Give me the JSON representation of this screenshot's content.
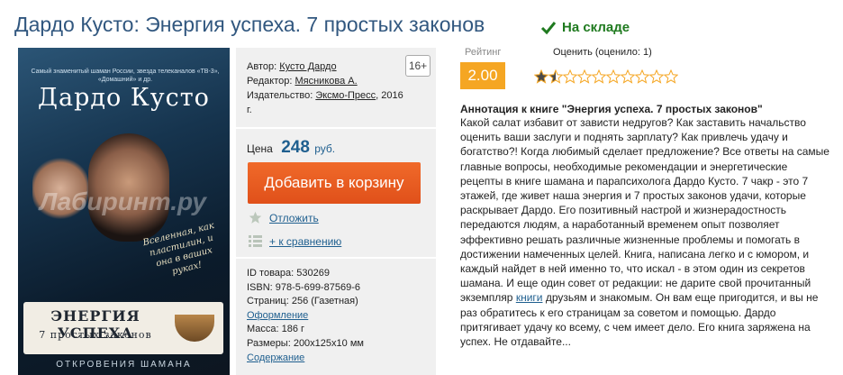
{
  "title": "Дардо Кусто: Энергия успеха. 7 простых законов",
  "stock": {
    "label": "На складе",
    "color": "#1f7a1f"
  },
  "cover": {
    "small_text": "Самый знаменитый шаман России, звезда телеканалов «ТВ-3», «Домашний» и др.",
    "author": "Дардо Кусто",
    "watermark": "Лабиринт.ру",
    "script": "Вселенная, как пластилин, и она в ваших руках!",
    "title1": "ЭНЕРГИЯ УСПЕХА",
    "title2": "7 простых законов",
    "series": "ОТКРОВЕНИЯ ШАМАНА"
  },
  "info": {
    "author_label": "Автор:",
    "author": "Кусто Дардо",
    "editor_label": "Редактор:",
    "editor": "Мясникова А.",
    "publisher_label": "Издательство:",
    "publisher": "Эксмо-Пресс",
    "year": ", 2016 г.",
    "age": "16+",
    "price_label": "Цена",
    "price": "248",
    "currency": "руб.",
    "cart_button": "Добавить в корзину",
    "defer": "Отложить",
    "compare": "+ к сравнению",
    "specs": {
      "id": "ID товара: 530269",
      "isbn": "ISBN: 978-5-699-87569-6",
      "pages": "Страниц: 256 (Газетная)",
      "design": "Оформление",
      "weight": "Масса: 186 г",
      "size": "Размеры: 200x125x10 мм",
      "contents": "Содержание"
    }
  },
  "rating": {
    "label": "Рейтинг",
    "value": "2.00",
    "rate_text": "Оценить (оценило: 1)",
    "stars_total": 10,
    "stars_filled": 1.5,
    "accent": "#f5a623"
  },
  "annotation": {
    "heading": "Аннотация к книге \"Энергия успеха. 7 простых законов\"",
    "text_before": "Какой салат избавит от зависти недругов? Как заставить начальство оценить ваши заслуги и поднять зарплату? Как привлечь удачу и богатство?! Когда любимый сделает предложение? Все ответы на самые главные вопросы, необходимые рекомендации и энергетические рецепты в книге шамана и парапсихолога Дардо Кусто. 7 чакр - это 7 этажей, где живет наша энергия и 7 простых законов удачи, которые раскрывает Дардо. Его позитивный настрой и жизнерадостность передаются людям, а наработанный временем опыт позволяет эффективно решать различные жизненные проблемы и помогать в достижении намеченных целей. Книга, написана легко и с юмором, и каждый найдет в ней именно то, что искал - в этом один из секретов шамана. И еще один совет от редакции: не дарите свой прочитанный экземпляр ",
    "link": "книги",
    "text_after": " друзьям и знакомым. Он вам еще пригодится, и вы не раз обратитесь к его страницам за советом и помощью. Дардо притягивает удачу ко всему, с чем имеет дело. Его книга заряжена на успех. Не отдавайте..."
  }
}
